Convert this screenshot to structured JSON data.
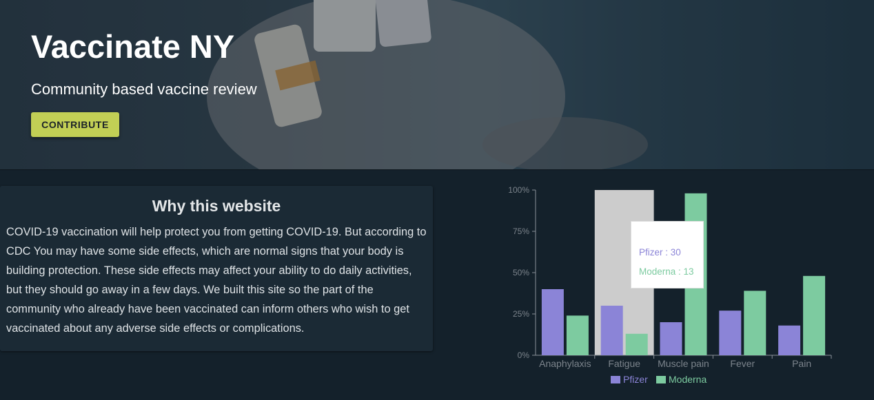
{
  "hero": {
    "title": "Vaccinate NY",
    "subtitle": "Community based vaccine review",
    "contribute_label": "CONTRIBUTE"
  },
  "why": {
    "title": "Why this website",
    "body": "COVID-19 vaccination will help protect you from getting COVID-19. But according to CDC You may have some side effects, which are normal signs that your body is building protection. These side effects may affect your ability to do daily activities, but they should go away in a few days. We built this site so the part of the community who already have been vaccinated can inform others who wish to get vaccinated about any adverse side effects or complications."
  },
  "colors": {
    "accent": "#c2cf55",
    "pfizer": "#8b84d7",
    "moderna": "#7dcba0",
    "background": "#14212b"
  },
  "tooltip": {
    "pfizer_text": "Pfizer : 30",
    "moderna_text": "Moderna : 13"
  },
  "chart_data": {
    "type": "bar",
    "categories": [
      "Anaphylaxis",
      "Fatigue",
      "Muscle pain",
      "Fever",
      "Pain"
    ],
    "series": [
      {
        "name": "Pfizer",
        "values": [
          40,
          30,
          20,
          27,
          18
        ],
        "color": "#8b84d7"
      },
      {
        "name": "Moderna",
        "values": [
          24,
          13,
          98,
          39,
          48
        ],
        "color": "#7dcba0"
      }
    ],
    "yticks": [
      "0%",
      "25%",
      "50%",
      "75%",
      "100%"
    ],
    "ylim": [
      0,
      100
    ],
    "legend": "bottom",
    "highlighted_category": "Fatigue"
  }
}
